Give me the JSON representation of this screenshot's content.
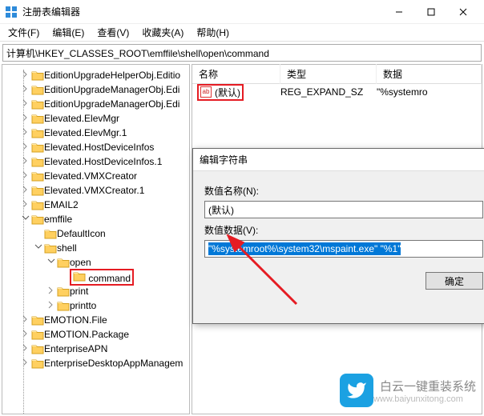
{
  "window": {
    "title": "注册表编辑器"
  },
  "menu": {
    "file": "文件(F)",
    "edit": "编辑(E)",
    "view": "查看(V)",
    "favorites": "收藏夹(A)",
    "help": "帮助(H)"
  },
  "address": "计算机\\HKEY_CLASSES_ROOT\\emffile\\shell\\open\\command",
  "tree": {
    "items": [
      "EditionUpgradeHelperObj.Editio",
      "EditionUpgradeManagerObj.Edi",
      "EditionUpgradeManagerObj.Edi",
      "Elevated.ElevMgr",
      "Elevated.ElevMgr.1",
      "Elevated.HostDeviceInfos",
      "Elevated.HostDeviceInfos.1",
      "Elevated.VMXCreator",
      "Elevated.VMXCreator.1",
      "EMAIL2"
    ],
    "emffile": "emffile",
    "defaulticon": "DefaultIcon",
    "shell": "shell",
    "open": "open",
    "command": "command",
    "print": "print",
    "printto": "printto",
    "after": [
      "EMOTION.File",
      "EMOTION.Package",
      "EnterpriseAPN",
      "EnterpriseDesktopAppManagem"
    ]
  },
  "columns": {
    "name": "名称",
    "type": "类型",
    "data": "数据"
  },
  "row": {
    "name": "(默认)",
    "type": "REG_EXPAND_SZ",
    "data": "\"%systemro"
  },
  "dialog": {
    "title": "编辑字符串",
    "name_label": "数值名称(N):",
    "name_value": "(默认)",
    "data_label": "数值数据(V):",
    "data_value": "\"%systemroot%\\system32\\mspaint.exe\" \"%1\"",
    "ok": "确定"
  },
  "watermark": {
    "text": "白云一键重装系统",
    "url": "www.baiyunxitong.com"
  },
  "icon_label": "ab"
}
